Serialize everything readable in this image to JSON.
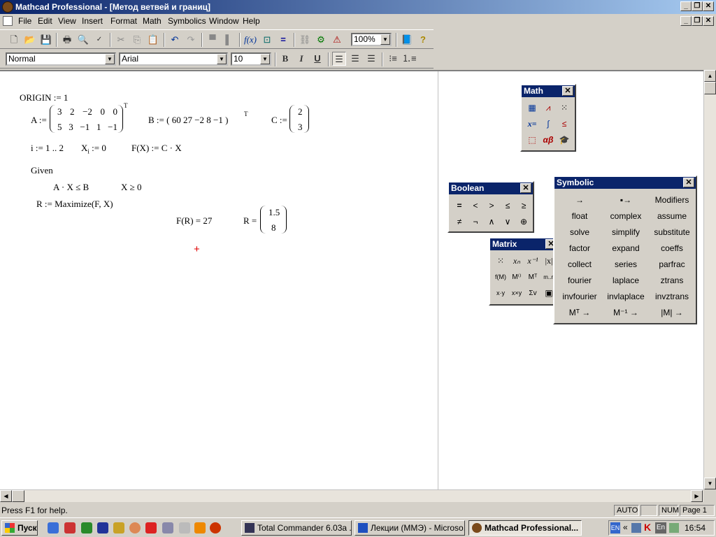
{
  "window": {
    "title": "Mathcad Professional - [Метод ветвей и границ]"
  },
  "menu": [
    "File",
    "Edit",
    "View",
    "Insert",
    "Format",
    "Math",
    "Symbolics",
    "Window",
    "Help"
  ],
  "toolbar": {
    "zoom": "100%",
    "style": "Normal",
    "font": "Arial",
    "size": "10",
    "bold": "B",
    "italic": "I",
    "underline": "U"
  },
  "worksheet": {
    "origin": "ORIGIN := 1",
    "a_label": "A :=",
    "a_row1": [
      "3",
      "2",
      "−2",
      "0",
      "0"
    ],
    "a_row2": [
      "5",
      "3",
      "−1",
      "1",
      "−1"
    ],
    "transpose": "T",
    "b_label": "B := ( 60  27  −2  8  −1 )",
    "c_label": "C :=",
    "c_vals": [
      "2",
      "3"
    ],
    "range": "i := 1 .. 2",
    "xi_x": "X",
    "xi_sub": "i",
    "xi_val": " := 0",
    "fx": "F(X) := C · X",
    "given": "Given",
    "c1": "A · X ≤ B",
    "c2": "X ≥ 0",
    "maximize": "R := Maximize(F, X)",
    "fr": "F(R) = 27",
    "r_label": "R =",
    "r_vals": [
      "1.5",
      "8"
    ]
  },
  "palettes": {
    "math": {
      "title": "Math"
    },
    "boolean": {
      "title": "Boolean",
      "buttons": [
        "=",
        "<",
        ">",
        "≤",
        "≥",
        "≠",
        "¬",
        "∧",
        "∨",
        "⊕"
      ]
    },
    "matrix": {
      "title": "Matrix"
    },
    "symbolic": {
      "title": "Symbolic",
      "items": [
        "→",
        "▪→",
        "Modifiers",
        "float",
        "complex",
        "assume",
        "solve",
        "simplify",
        "substitute",
        "factor",
        "expand",
        "coeffs",
        "collect",
        "series",
        "parfrac",
        "fourier",
        "laplace",
        "ztrans",
        "invfourier",
        "invlaplace",
        "invztrans",
        "Mᵀ →",
        "M⁻¹ →",
        "|M| →"
      ]
    }
  },
  "status": {
    "help": "Press F1 for help.",
    "auto": "AUTO",
    "num": "NUM",
    "page": "Page 1"
  },
  "taskbar": {
    "start": "Пуск",
    "tasks": [
      "Total Commander 6.03a ...",
      "Лекции (ММЭ) - Microso...",
      "Mathcad Professional..."
    ],
    "time": "16:54",
    "lang": "En"
  }
}
